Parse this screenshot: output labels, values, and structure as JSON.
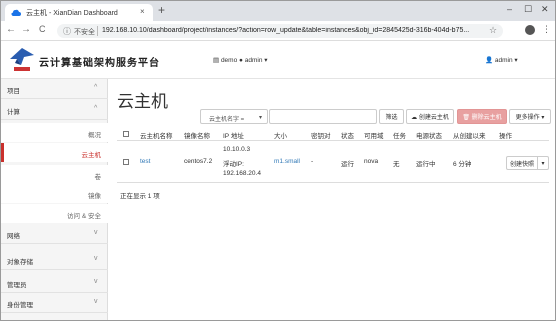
{
  "browser": {
    "tab_title": "云主机 - XianDian Dashboard",
    "tab_close": "×",
    "new_tab": "+",
    "minimize": "–",
    "maximize": "☐",
    "close": "✕",
    "back": "←",
    "forward": "→",
    "reload": "C",
    "info": "ⓘ",
    "insecure_label": "不安全",
    "url": "192.168.10.10/dashboard/project/instances/?action=row_update&table=instances&obj_id=2845425d-316b-404d-b75...",
    "star": "☆",
    "menu": "⋮"
  },
  "header": {
    "brand": "云计算基础架构服务平台",
    "project_selector": "▤ demo ● admin ▾",
    "user_menu": "👤 admin ▾"
  },
  "sidebar": {
    "project": "项目",
    "compute": "计算",
    "items": [
      {
        "label": "概况"
      },
      {
        "label": "云主机"
      },
      {
        "label": "卷"
      },
      {
        "label": "镜像"
      },
      {
        "label": "访问 & 安全"
      }
    ],
    "network": "网络",
    "object_store": "对象存储",
    "admin": "管理员",
    "identity": "身份管理",
    "chev_up": "^",
    "chev_down": "v"
  },
  "main": {
    "title": "云主机",
    "filter_field": "云主机名字 =",
    "filter_caret": "▾",
    "filter_button": "筛选",
    "create_button": "☁ 创建云主机",
    "delete_button": "🗑 删除云主机",
    "more_button": "更多操作 ▾",
    "columns": [
      "云主机名称",
      "镜像名称",
      "IP 地址",
      "大小",
      "密钥对",
      "状态",
      "可用域",
      "任务",
      "电源状态",
      "从创建以来",
      "操作"
    ],
    "rows": [
      {
        "name": "test",
        "image": "centos7.2",
        "ip1": "10.10.0.3",
        "ip2": "浮动IP:",
        "ip3": "192.168.20.4",
        "size": "m1.small",
        "keypair": "-",
        "status": "运行",
        "zone": "nova",
        "task": "无",
        "power": "运行中",
        "age": "6 分钟",
        "action": "创建快照",
        "action_caret": "▾"
      }
    ],
    "showing": "正在显示 1 项"
  },
  "colors": {
    "accent_red": "#c9302c",
    "link_blue": "#337ab7",
    "delete_pink": "#e8a0a0"
  }
}
